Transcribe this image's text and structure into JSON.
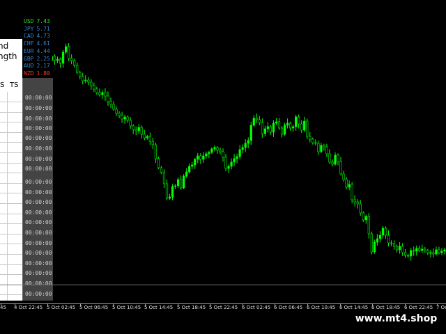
{
  "chart": {
    "candle_color": "#00ff00",
    "background": "#000000",
    "series": [
      62,
      60,
      60,
      58,
      58,
      60,
      56,
      58,
      72,
      74,
      68,
      76,
      70,
      66,
      58,
      52,
      54,
      55,
      49,
      55,
      53,
      59,
      43,
      35,
      52,
      55,
      62,
      72,
      78,
      84,
      83,
      86,
      91,
      96,
      101,
      104,
      101,
      106,
      114,
      118,
      125,
      131,
      134,
      139,
      136,
      141,
      149,
      154,
      156,
      151,
      161,
      166,
      164,
      171,
      176,
      196,
      209,
      216,
      232,
      253,
      251,
      236,
      235,
      226,
      238,
      221,
      215,
      207,
      205,
      197,
      192,
      197,
      192,
      189,
      187,
      182,
      180,
      184,
      186,
      194,
      210,
      207,
      201,
      196,
      193,
      183,
      180,
      174,
      170,
      148,
      138,
      140,
      144,
      160,
      153,
      150,
      158,
      145,
      143,
      152,
      161,
      148,
      145,
      152,
      150,
      136,
      146,
      155,
      142,
      164,
      168,
      173,
      174,
      186,
      177,
      179,
      189,
      201,
      204,
      191,
      200,
      218,
      226,
      237,
      233,
      255,
      258,
      261,
      274,
      284,
      279,
      304,
      330,
      316,
      311,
      306,
      296,
      306,
      317,
      318,
      322,
      327,
      322,
      331,
      335,
      336,
      328,
      329,
      325,
      328,
      326,
      328,
      331,
      331,
      333,
      327,
      331,
      329,
      327
    ]
  },
  "side_panel": {
    "trend_lines": [
      "nd",
      "ngth"
    ],
    "col_headers": [
      "S",
      "TS"
    ],
    "currencies": [
      {
        "code": "USD",
        "value": "7.43",
        "color": "#33dd33"
      },
      {
        "code": "JPY",
        "value": "5.71",
        "color": "#3a7fd0"
      },
      {
        "code": "CAD",
        "value": "4.73",
        "color": "#3a7fd0"
      },
      {
        "code": "CHF",
        "value": "4.61",
        "color": "#3a7fd0"
      },
      {
        "code": "EUR",
        "value": "4.44",
        "color": "#3a7fd0"
      },
      {
        "code": "GBP",
        "value": "2.25",
        "color": "#3a7fd0"
      },
      {
        "code": "AUD",
        "value": "2.17",
        "color": "#3a7fd0"
      },
      {
        "code": "NZD",
        "value": "1.80",
        "color": "#ff3333"
      }
    ],
    "times": [
      "00:00:00",
      "00:00:00",
      "00:00:00",
      "00:00:00",
      "00:00:00",
      "00:00:00",
      "00:00:00",
      "00:00:00",
      "00:00:00",
      "00:00:00",
      "00:00:00",
      "00:00:00",
      "00:00:00",
      "00:00:00",
      "00:00:00",
      "00:00:00",
      "00:00:00",
      "00:00:00",
      "00:00:00",
      "00:00:00",
      "00:00:00"
    ]
  },
  "x_axis": {
    "labels": [
      "45",
      "4 Oct 22:45",
      "5 Oct 02:45",
      "5 Oct 06:45",
      "5 Oct 10:45",
      "5 Oct 14:45",
      "5 Oct 18:45",
      "5 Oct 22:45",
      "6 Oct 02:45",
      "6 Oct 06:45",
      "6 Oct 10:45",
      "6 Oct 14:45",
      "6 Oct 18:45",
      "6 Oct 22:45",
      "7 Oc"
    ]
  },
  "watermark": "www.mt4.shop"
}
